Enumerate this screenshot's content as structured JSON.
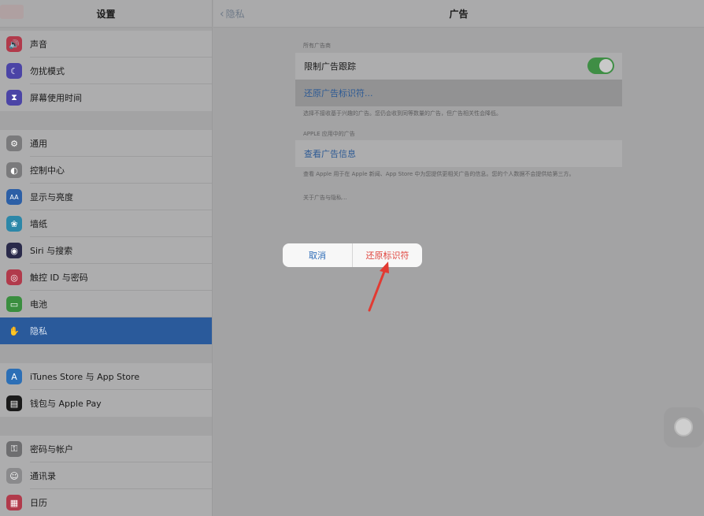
{
  "sidebar": {
    "title": "设置",
    "groups": [
      [
        {
          "label": "声音",
          "color": "#b13a4b",
          "glyph": "🔊"
        },
        {
          "label": "勿扰模式",
          "color": "#4b44a6",
          "glyph": "☾"
        },
        {
          "label": "屏幕使用时间",
          "color": "#4b44a6",
          "glyph": "⧗"
        }
      ],
      [
        {
          "label": "通用",
          "color": "#7a7a7c",
          "glyph": "⚙"
        },
        {
          "label": "控制中心",
          "color": "#7a7a7c",
          "glyph": "◐"
        },
        {
          "label": "显示与亮度",
          "color": "#2c5fa6",
          "glyph": "AA"
        },
        {
          "label": "墙纸",
          "color": "#2c87a8",
          "glyph": "❀"
        },
        {
          "label": "Siri 与搜索",
          "color": "#2a2a4a",
          "glyph": "◉"
        },
        {
          "label": "触控 ID 与密码",
          "color": "#b13a4b",
          "glyph": "◎"
        },
        {
          "label": "电池",
          "color": "#3a8e3f",
          "glyph": "▭"
        },
        {
          "label": "隐私",
          "color": "#2a5a9b",
          "glyph": "✋",
          "selected": true
        }
      ],
      [
        {
          "label": "iTunes Store 与 App Store",
          "color": "#2c6fb6",
          "glyph": "A"
        },
        {
          "label": "钱包与 Apple Pay",
          "color": "#1a1a1a",
          "glyph": "▤"
        }
      ],
      [
        {
          "label": "密码与帐户",
          "color": "#6e6e70",
          "glyph": "⚿"
        },
        {
          "label": "通讯录",
          "color": "#8a8a8c",
          "glyph": "☺"
        },
        {
          "label": "日历",
          "color": "#b13a4b",
          "glyph": "▦"
        }
      ]
    ]
  },
  "main": {
    "back_label": "隐私",
    "title": "广告",
    "section1_header": "所有广告商",
    "limit_tracking_label": "限制广告跟踪",
    "limit_tracking_on": true,
    "reset_identifier_label": "还原广告标识符...",
    "footnote1": "选择不接收基于兴趣的广告。您仍会收到同等数量的广告，但广告相关性会降低。",
    "section2_header": "APPLE 应用中的广告",
    "view_ad_info_label": "查看广告信息",
    "footnote2": "查看 Apple 用于在 Apple 新闻、App Store 中为您提供更相关广告的信息。您的个人数据不会提供给第三方。",
    "about_link": "关于广告与隐私..."
  },
  "alert": {
    "cancel_label": "取消",
    "confirm_label": "还原标识符"
  },
  "colors": {
    "selected_bg": "#2a5a9b",
    "toggle_on": "#3f8e45",
    "alert_confirm": "#e0453e",
    "arrow": "#e23a32"
  }
}
